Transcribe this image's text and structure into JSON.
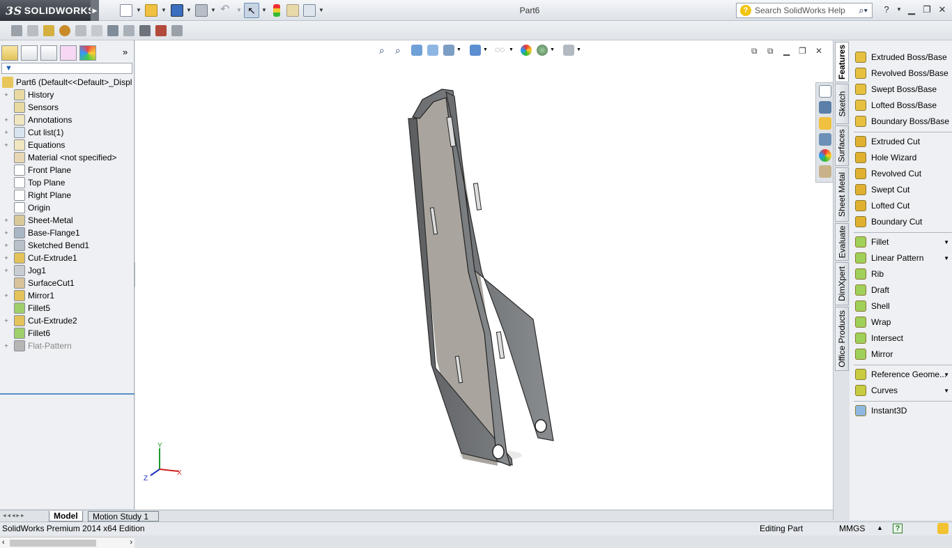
{
  "app": {
    "brand": "SOLIDWORKS",
    "brand_mark": "3S",
    "doc_title": "Part6"
  },
  "search": {
    "placeholder": "Search SolidWorks Help"
  },
  "feature_tree": {
    "filter_symbol": "▼",
    "root": "Part6  (Default<<Default>_Displ",
    "items": [
      {
        "label": "History",
        "expand": "+"
      },
      {
        "label": "Sensors",
        "expand": ""
      },
      {
        "label": "Annotations",
        "expand": "+"
      },
      {
        "label": "Cut list(1)",
        "expand": "+"
      },
      {
        "label": "Equations",
        "expand": "+"
      },
      {
        "label": "Material <not specified>",
        "expand": ""
      },
      {
        "label": "Front Plane",
        "expand": ""
      },
      {
        "label": "Top Plane",
        "expand": ""
      },
      {
        "label": "Right Plane",
        "expand": ""
      },
      {
        "label": "Origin",
        "expand": ""
      },
      {
        "label": "Sheet-Metal",
        "expand": "+"
      },
      {
        "label": "Base-Flange1",
        "expand": "+"
      },
      {
        "label": "Sketched Bend1",
        "expand": "+"
      },
      {
        "label": "Cut-Extrude1",
        "expand": "+"
      },
      {
        "label": "Jog1",
        "expand": "+"
      },
      {
        "label": "SurfaceCut1",
        "expand": ""
      },
      {
        "label": "Mirror1",
        "expand": "+"
      },
      {
        "label": "Fillet5",
        "expand": ""
      },
      {
        "label": "Cut-Extrude2",
        "expand": "+"
      },
      {
        "label": "Fillet6",
        "expand": ""
      },
      {
        "label": "Flat-Pattern",
        "expand": "+"
      }
    ]
  },
  "vertical_tabs": [
    "Features",
    "Sketch",
    "Surfaces",
    "Sheet Metal",
    "Evaluate",
    "DimXpert",
    "Office Products"
  ],
  "command_manager": {
    "group1": [
      "Extruded Boss/Base",
      "Revolved Boss/Base",
      "Swept Boss/Base",
      "Lofted Boss/Base",
      "Boundary Boss/Base"
    ],
    "group2": [
      "Extruded Cut",
      "Hole Wizard",
      "Revolved Cut",
      "Swept Cut",
      "Lofted Cut",
      "Boundary Cut"
    ],
    "group3": [
      "Fillet",
      "Linear Pattern",
      "Rib",
      "Draft",
      "Shell",
      "Wrap",
      "Intersect",
      "Mirror"
    ],
    "group4": [
      "Reference Geome...",
      "Curves"
    ],
    "group5": [
      "Instant3D"
    ]
  },
  "triad": {
    "y": "Y",
    "x": "X",
    "z": "Z"
  },
  "bottom_tabs": {
    "model": "Model",
    "motion": "Motion Study 1"
  },
  "status": {
    "edition": "SolidWorks Premium 2014 x64 Edition",
    "mode": "Editing Part",
    "units": "MMGS",
    "help": "?"
  }
}
